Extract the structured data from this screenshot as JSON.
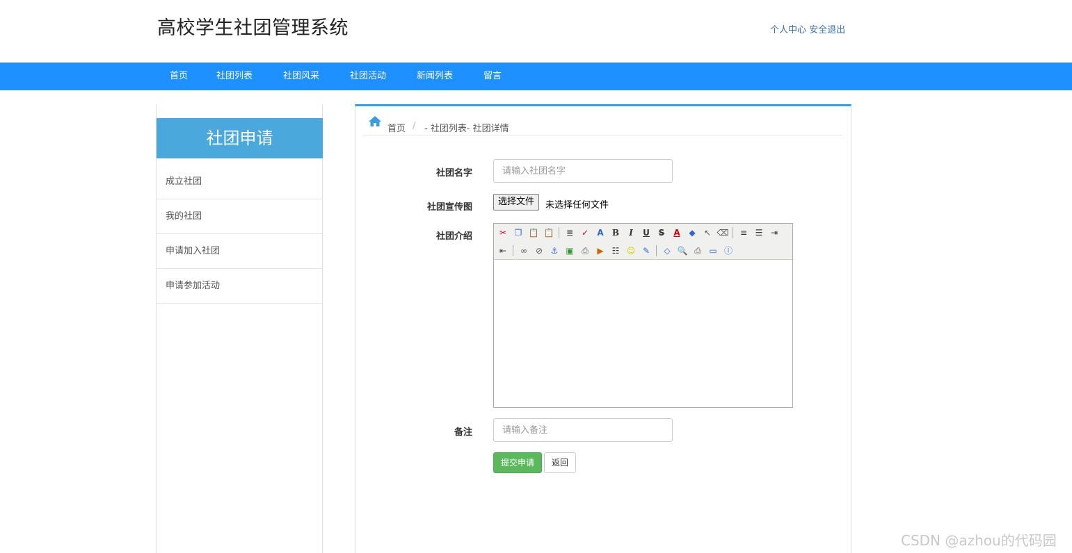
{
  "header": {
    "title": "高校学生社团管理系统",
    "personal_center": "个人中心",
    "logout": "安全退出"
  },
  "nav": {
    "items": [
      "首页",
      "社团列表",
      "社团风采",
      "社团活动",
      "新闻列表",
      "留言"
    ]
  },
  "sidebar": {
    "title": "社团申请",
    "items": [
      "成立社团",
      "我的社团",
      "申请加入社团",
      "申请参加活动"
    ]
  },
  "breadcrumb": {
    "home": "首页",
    "separator": "/",
    "rest": "- 社团列表- 社团详情"
  },
  "form": {
    "name_label": "社团名字",
    "name_placeholder": "请输入社团名字",
    "image_label": "社团宣传图",
    "file_button": "选择文件",
    "file_status": "未选择任何文件",
    "intro_label": "社团介绍",
    "remark_label": "备注",
    "remark_placeholder": "请输入备注",
    "submit": "提交申请",
    "back": "返回"
  },
  "editor_toolbar_icons": [
    "cut-icon",
    "copy-icon",
    "paste-icon",
    "paste-text-icon",
    "format-icon",
    "spellcheck-icon",
    "font-size-icon",
    "bold-icon",
    "italic-icon",
    "underline-icon",
    "strikethrough-icon",
    "font-color-icon",
    "bg-color-icon",
    "select-icon",
    "eraser-icon",
    "align-left-icon",
    "list-icon",
    "indent-icon",
    "outdent-icon",
    "link-icon",
    "unlink-icon",
    "anchor-icon",
    "image-icon",
    "flash-icon",
    "media-icon",
    "hr-icon",
    "emoticon-icon",
    "edit-icon",
    "source-icon",
    "preview-icon",
    "print-icon",
    "fullscreen-icon",
    "about-icon"
  ],
  "watermark": "CSDN @azhou的代码园",
  "colors": {
    "nav_bg": "#1e90ff",
    "sidebar_title_bg": "#4aa8dd",
    "submit_bg": "#5cb85c"
  }
}
